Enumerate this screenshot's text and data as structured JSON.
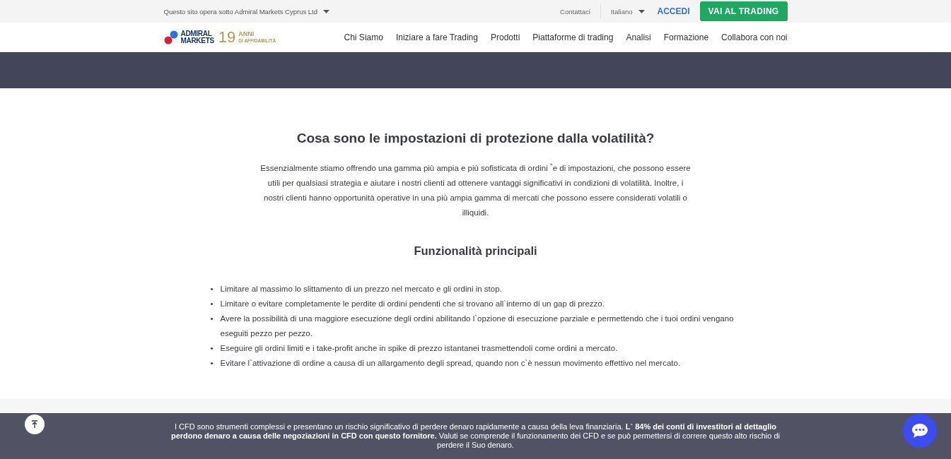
{
  "top_bar": {
    "entity": "Questo sito opera sotto Admiral Markets Cyprus Ltd",
    "contact": "Contattaci",
    "language": "Italiano",
    "login": "ACCEDI",
    "cta": "VAI AL TRADING"
  },
  "header": {
    "logo_line_1": "ADMIRAL",
    "logo_line_2": "MARKETS",
    "years": "19",
    "years_line_1": "ANNI",
    "years_line_2": "DI AFFIDABILITÀ",
    "nav": [
      "Chi Siamo",
      "Iniziare a fare Trading",
      "Prodotti",
      "Piattaforme di trading",
      "Analisi",
      "Formazione",
      "Collabora con noi"
    ]
  },
  "section": {
    "title": "Cosa sono le impostazioni di protezione dalla volatilità?",
    "intro": "Essenzialmente stiamo offrendo una gamma più ampia e più sofisticata di ordini $^{*}$e di impostazioni, che possono essere utili per qualsiasi strategia e aiutare i nostri clienti ad ottenere vantaggi significativi in condizioni di volatilità. Inoltre, i nostri clienti hanno opportunità operative in una più ampia gamma di mercati che possono essere considerati volatili o illiquidi.",
    "subtitle": "Funzionalità principali",
    "bullet": "•",
    "features": [
      "Limitare al massimo lo slittamento di un prezzo nel mercato e gli ordini in stop.",
      "Limitare o evitare completamente le perdite di ordini pendenti che si trovano all`interno di un gap di prezzo.",
      "Avere la possibilità di una maggiore esecuzione degli ordini abilitando l`opzione di esecuzione parziale e permettendo che i tuoi ordini vengano eseguiti pezzo per pezzo.",
      "Eseguire gli ordini limiti e i take-profit anche in spike di prezzo istantanei trasmettendoli come ordini a mercato.",
      "Evitare l`attivazione di ordine a causa di un allargamento degli spread, quando non c`è nessun movimento effettivo nel mercato."
    ]
  },
  "risk_banner": {
    "text": "I CFD sono strumenti complessi e presentano un rischio significativo di perdere denaro rapidamente a causa della leva finanziaria. **L` 84% dei conti di investitori al dettaglio perdono denaro a causa delle negoziazioni in CFD con questo fornitore.** Valuti se comprende il funzionamento dei CFD e se può permettersi di correre questo alto rischio di perdere il Suo denaro."
  }
}
